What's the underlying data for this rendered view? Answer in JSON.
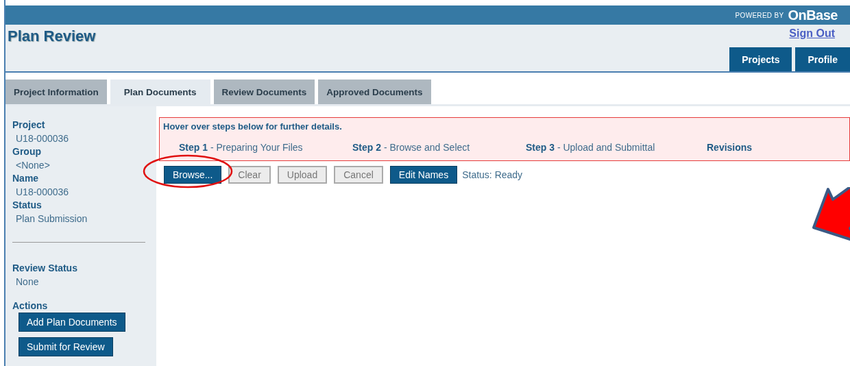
{
  "header": {
    "powered_by": "POWERED BY",
    "brand": "OnBase",
    "title": "Plan Review",
    "sign_out": "Sign Out",
    "nav": [
      {
        "label": "Projects"
      },
      {
        "label": "Profile"
      }
    ]
  },
  "tabs": [
    {
      "label": "Project Information",
      "selected": false
    },
    {
      "label": "Plan Documents",
      "selected": true
    },
    {
      "label": "Review Documents",
      "selected": false
    },
    {
      "label": "Approved Documents",
      "selected": false
    }
  ],
  "sidebar": {
    "fields": [
      {
        "label": "Project",
        "value": "U18-000036"
      },
      {
        "label": "Group",
        "value": "<None>"
      },
      {
        "label": "Name",
        "value": "U18-000036"
      },
      {
        "label": "Status",
        "value": "Plan Submission"
      }
    ],
    "review_status": {
      "label": "Review Status",
      "value": "None"
    },
    "actions_label": "Actions",
    "actions": [
      "Add Plan Documents",
      "Submit for Review"
    ]
  },
  "instructions": {
    "heading": "Hover over steps below for further details.",
    "steps": [
      "**Step 1** - Preparing Your Files",
      "**Step 2** - Browse and Select",
      "**Step 3** - Upload and Submittal",
      "**Revisions**"
    ]
  },
  "toolbar": {
    "buttons": [
      {
        "label": "Browse...",
        "disabled": false
      },
      {
        "label": "Clear",
        "disabled": true
      },
      {
        "label": "Upload",
        "disabled": true
      },
      {
        "label": "Cancel",
        "disabled": true
      },
      {
        "label": "Edit Names",
        "disabled": false
      }
    ],
    "status": "Status: Ready"
  }
}
